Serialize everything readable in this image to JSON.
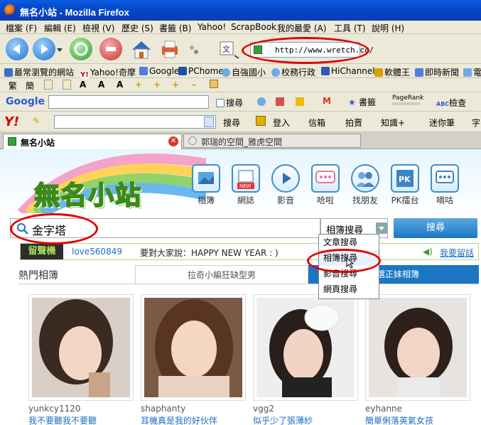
{
  "window": {
    "title": "無名小站 - Mozilla Firefox"
  },
  "menu": [
    "檔案 (F)",
    "編輯 (E)",
    "檢視 (V)",
    "歷史 (S)",
    "書籤 (B)",
    "Yahoo!",
    "ScrapBook",
    "我的最愛 (A)",
    "工具 (T)",
    "說明 (H)"
  ],
  "address": {
    "url": "http://www.wretch.cc/"
  },
  "bookmarks": [
    "最常瀏覽的網站",
    "Yahoo!奇摩",
    "Google",
    "PChome",
    "自強國小",
    "校務行政",
    "HiChannel",
    "軟體王",
    "即時新聞",
    "電"
  ],
  "toolbar3": {
    "trad": "繁",
    "simp": "簡"
  },
  "google_bar": {
    "logo": "Google",
    "search": "搜尋",
    "bookmarks": "書籤",
    "pagerank": "PageRank",
    "check": "檢查"
  },
  "yahoo_bar": {
    "search": "搜尋",
    "login": "登入",
    "mail": "信箱",
    "auction": "拍賣",
    "knowledge": "知識+",
    "blog": "迷你筆",
    "dict": "字"
  },
  "tabs": [
    {
      "label": "無名小站"
    },
    {
      "label": "郭瑞的空間_雅虎空間"
    }
  ],
  "site": {
    "logo": "無名小站",
    "nav": [
      "相簿",
      "網誌",
      "影音",
      "哈啦",
      "找朋友",
      "PK擂台",
      "嘀咕"
    ],
    "new_badge": "NEW"
  },
  "search": {
    "query": "金字塔",
    "selected": "相簿搜尋",
    "button": "搜尋",
    "options": [
      "文章搜尋",
      "相簿搜尋",
      "影音搜尋",
      "網頁搜尋"
    ]
  },
  "shout": {
    "label": "留聲機",
    "user": "love560849",
    "text": "要對大家說：HAPPY NEW YEAR : )",
    "link": "我要留話"
  },
  "albums": {
    "section": "熱門相簿",
    "tab_left": "拉奇小編狂缺型男",
    "tab_right": "精選正妹相簿",
    "items": [
      {
        "user": "yunkcy1120",
        "title": "我不要聽我不要聽"
      },
      {
        "user": "shaphanty",
        "title": "耳機真是我的好伙伴"
      },
      {
        "user": "vgg2",
        "title": "似乎少了張薄紗"
      },
      {
        "user": "eyhanne",
        "title": "簡單俐落英氣女孩"
      }
    ]
  }
}
